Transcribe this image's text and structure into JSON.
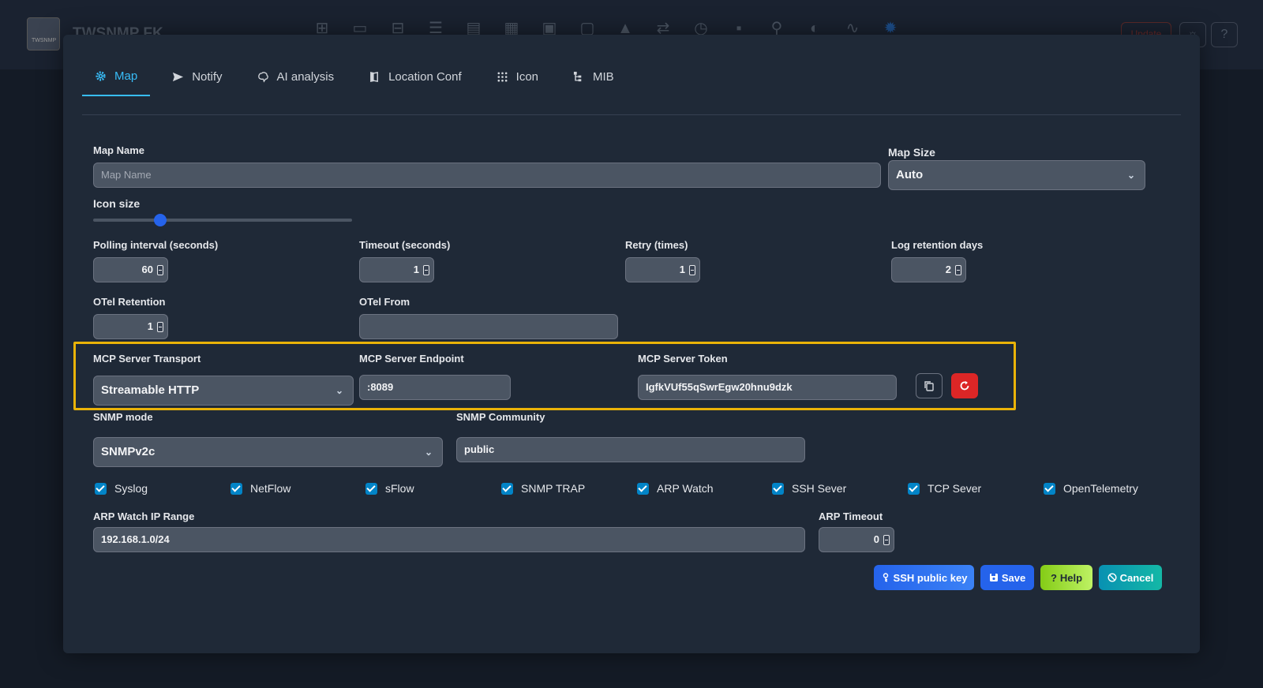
{
  "app": {
    "title": "TWSNMP FK",
    "logo_text": "TWSNMP",
    "update_label": "Update"
  },
  "tabs": [
    {
      "label": "Map",
      "icon": "gear-icon",
      "active": true
    },
    {
      "label": "Notify",
      "icon": "send-icon",
      "active": false
    },
    {
      "label": "AI analysis",
      "icon": "brain-icon",
      "active": false
    },
    {
      "label": "Location Conf",
      "icon": "map-icon",
      "active": false
    },
    {
      "label": "Icon",
      "icon": "grid-icon",
      "active": false
    },
    {
      "label": "MIB",
      "icon": "tree-icon",
      "active": false
    }
  ],
  "form": {
    "map_name": {
      "label": "Map Name",
      "placeholder": "Map Name",
      "value": ""
    },
    "map_size": {
      "label": "Map Size",
      "value": "Auto"
    },
    "icon_size": {
      "label": "Icon size",
      "value_fraction": 0.26
    },
    "polling": {
      "label": "Polling interval (seconds)",
      "value": "60"
    },
    "timeout": {
      "label": "Timeout (seconds)",
      "value": "1"
    },
    "retry": {
      "label": "Retry (times)",
      "value": "1"
    },
    "log_retention": {
      "label": "Log retention days",
      "value": "2"
    },
    "otel_retention": {
      "label": "OTel Retention",
      "value": "1"
    },
    "otel_from": {
      "label": "OTel From",
      "value": ""
    },
    "mcp_transport": {
      "label": "MCP Server Transport",
      "value": "Streamable HTTP"
    },
    "mcp_endpoint": {
      "label": "MCP Server Endpoint",
      "value": ":8089"
    },
    "mcp_token": {
      "label": "MCP Server Token",
      "value": "IgfkVUf55qSwrEgw20hnu9dzk"
    },
    "snmp_mode": {
      "label": "SNMP mode",
      "value": "SNMPv2c"
    },
    "snmp_community": {
      "label": "SNMP Community",
      "value": "public"
    },
    "checkboxes": [
      {
        "label": "Syslog",
        "checked": true
      },
      {
        "label": "NetFlow",
        "checked": true
      },
      {
        "label": "sFlow",
        "checked": true
      },
      {
        "label": "SNMP TRAP",
        "checked": true
      },
      {
        "label": "ARP Watch",
        "checked": true
      },
      {
        "label": "SSH Sever",
        "checked": true
      },
      {
        "label": "TCP Sever",
        "checked": true
      },
      {
        "label": "OpenTelemetry",
        "checked": true
      }
    ],
    "arp_range": {
      "label": "ARP Watch IP Range",
      "value": "192.168.1.0/24"
    },
    "arp_timeout": {
      "label": "ARP Timeout",
      "value": "0"
    }
  },
  "buttons": {
    "ssh": "SSH public key",
    "save": "Save",
    "help": "Help",
    "cancel": "Cancel"
  },
  "colors": {
    "accent": "#38bdf8",
    "highlight": "#eab308",
    "danger": "#dc2626",
    "primary": "#2563eb"
  }
}
